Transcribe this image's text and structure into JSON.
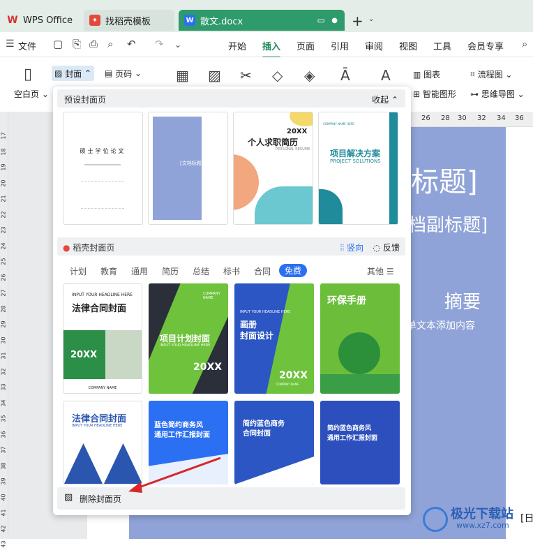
{
  "tabs": [
    {
      "label": "WPS Office"
    },
    {
      "label": "找稻壳模板"
    },
    {
      "label": "散文.docx"
    }
  ],
  "menu": {
    "file": "文件",
    "items": [
      "开始",
      "插入",
      "页面",
      "引用",
      "审阅",
      "视图",
      "工具",
      "会员专享"
    ]
  },
  "ribbon": {
    "blank": "空白页",
    "cover": "封面",
    "pagenum": "页码",
    "chart": "图表",
    "flowchart": "流程图",
    "smartart": "智能图形",
    "mindmap": "思维导图"
  },
  "ruler": [
    "26",
    "28",
    "30",
    "32",
    "34",
    "36"
  ],
  "leftruler": [
    "17",
    "18",
    "19",
    "20",
    "21",
    "22",
    "23",
    "24",
    "25",
    "26",
    "27",
    "28",
    "29",
    "30",
    "31",
    "32",
    "33",
    "34",
    "35",
    "36",
    "37",
    "38",
    "39",
    "40",
    "41",
    "42",
    "43"
  ],
  "cover": {
    "title": "标题]",
    "subtitle": "档副标题]",
    "abstract": "摘要",
    "body": "单文本添加内容",
    "corner": "[日"
  },
  "popup": {
    "preset_label": "预设封面页",
    "collapse": "收起",
    "preset": [
      {
        "title": "硕士学位论文"
      },
      {
        "title": "[文档标题]"
      },
      {
        "year": "20XX",
        "title": "个人求职简历",
        "en": "PERSONAL RESUME"
      },
      {
        "en": "COMPANY NAME HERE",
        "title": "项目解决方案",
        "sub": "PROJECT SOLUTIONS"
      }
    ],
    "daoke_label": "稻壳封面页",
    "vertical": "竖向",
    "feedback": "反馈",
    "categories": [
      "计划",
      "教育",
      "通用",
      "简历",
      "总结",
      "标书",
      "合同",
      "免费"
    ],
    "more": "其他",
    "cards": [
      {
        "en": "INPUT YOUR HEADLINE HERE",
        "title": "法律合同封面",
        "year": "20XX",
        "foot": "COMPANY NAME"
      },
      {
        "en": "COMPANY NAME",
        "title": "项目计划封面",
        "sub": "INPUT YOUR HEADLINE HERE",
        "year": "20XX"
      },
      {
        "en": "INPUT YOUR HEADLINE HERE",
        "title": "画册",
        "title2": "封面设计",
        "year": "20XX",
        "foot": "COMPANY NAME"
      },
      {
        "title": "环保手册"
      },
      {
        "title": "法律合同封面",
        "en": "INPUT YOUR HEADLINE HERE"
      },
      {
        "title": "蓝色简约商务风",
        "title2": "通用工作汇报封面"
      },
      {
        "title": "简约蓝色商务",
        "title2": "合同封面"
      },
      {
        "title": "简约蓝色商务风",
        "title2": "通用工作汇报封面"
      }
    ],
    "delete": "删除封面页"
  },
  "watermark": {
    "title": "极光下载站",
    "url": "www.xz7.com"
  }
}
